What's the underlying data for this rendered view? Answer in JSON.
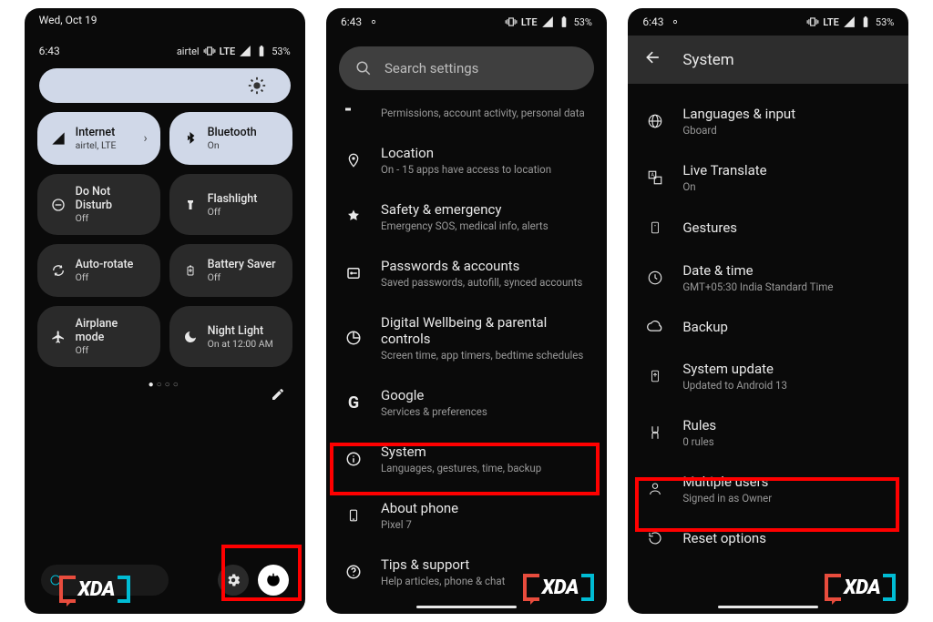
{
  "status": {
    "time": "6:43",
    "date": "Wed, Oct 19",
    "carrier": "airtel",
    "network": "LTE",
    "battery": "53%"
  },
  "brand": "XDA",
  "qs": {
    "tiles": [
      {
        "title": "Internet",
        "sub": "airtel, LTE"
      },
      {
        "title": "Bluetooth",
        "sub": "On"
      },
      {
        "title": "Do Not Disturb",
        "sub": "Off"
      },
      {
        "title": "Flashlight",
        "sub": "Off"
      },
      {
        "title": "Auto-rotate",
        "sub": "Off"
      },
      {
        "title": "Battery Saver",
        "sub": "Off"
      },
      {
        "title": "Airplane mode",
        "sub": "Off"
      },
      {
        "title": "Night Light",
        "sub": "On at 12:00 AM"
      }
    ]
  },
  "settings": {
    "searchPlaceholder": "Search settings",
    "items": [
      {
        "title": "",
        "sub": "Permissions, account activity, personal data"
      },
      {
        "title": "Location",
        "sub": "On - 15 apps have access to location"
      },
      {
        "title": "Safety & emergency",
        "sub": "Emergency SOS, medical info, alerts"
      },
      {
        "title": "Passwords & accounts",
        "sub": "Saved passwords, autofill, synced accounts"
      },
      {
        "title": "Digital Wellbeing & parental controls",
        "sub": "Screen time, app timers, bedtime schedules"
      },
      {
        "title": "Google",
        "sub": "Services & preferences"
      },
      {
        "title": "System",
        "sub": "Languages, gestures, time, backup"
      },
      {
        "title": "About phone",
        "sub": "Pixel 7"
      },
      {
        "title": "Tips & support",
        "sub": "Help articles, phone & chat"
      }
    ]
  },
  "system": {
    "header": "System",
    "items": [
      {
        "title": "Languages & input",
        "sub": "Gboard"
      },
      {
        "title": "Live Translate",
        "sub": "On"
      },
      {
        "title": "Gestures",
        "sub": ""
      },
      {
        "title": "Date & time",
        "sub": "GMT+05:30 India Standard Time"
      },
      {
        "title": "Backup",
        "sub": ""
      },
      {
        "title": "System update",
        "sub": "Updated to Android 13"
      },
      {
        "title": "Rules",
        "sub": "0 rules"
      },
      {
        "title": "Multiple users",
        "sub": "Signed in as Owner"
      },
      {
        "title": "Reset options",
        "sub": ""
      }
    ]
  }
}
